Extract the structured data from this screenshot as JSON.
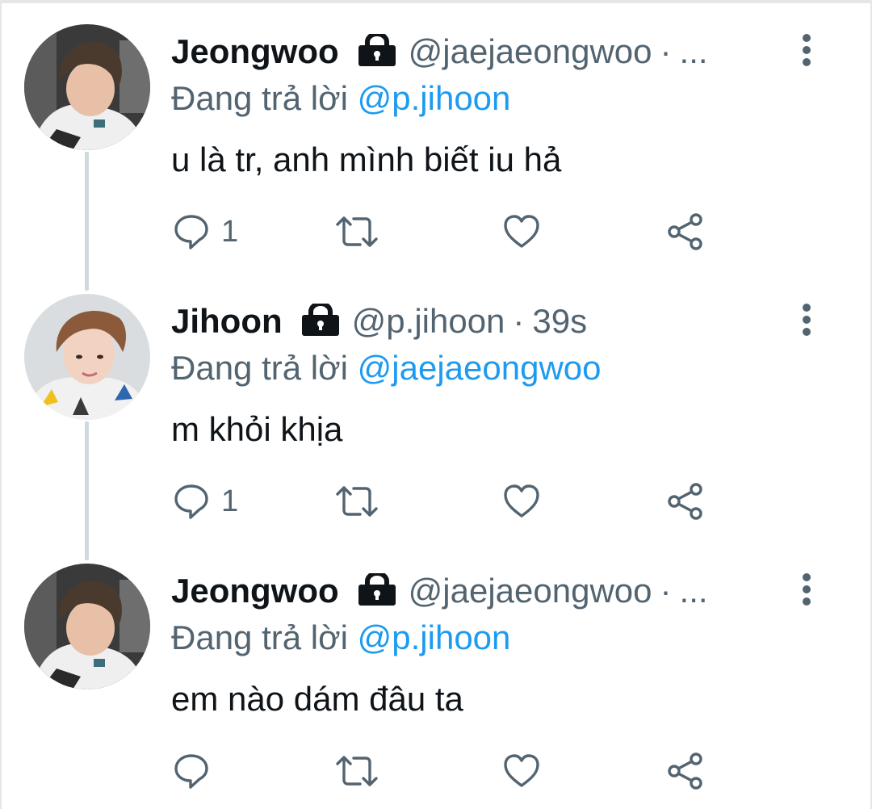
{
  "colors": {
    "name": "#0f1419",
    "secondary": "#536471",
    "mention": "#1d9bf0",
    "thread_line": "#cfd9de"
  },
  "tweets": [
    {
      "name": "Jeongwoo",
      "handle": "@jaejaeongwoo",
      "separator": "·",
      "time": "...",
      "reply_prefix": "Đang trả lời",
      "reply_to": "@p.jihoon",
      "text": "u là tr, anh mình biết iu hả",
      "reply_count": "1",
      "icons": [
        "lock-icon",
        "more-vertical-icon",
        "reply-icon",
        "retweet-icon",
        "like-icon",
        "share-icon"
      ]
    },
    {
      "name": "Jihoon",
      "handle": "@p.jihoon",
      "separator": "·",
      "time": "39s",
      "reply_prefix": "Đang trả lời",
      "reply_to": "@jaejaeongwoo",
      "text": "m khỏi khịa",
      "reply_count": "1",
      "icons": [
        "lock-icon",
        "more-vertical-icon",
        "reply-icon",
        "retweet-icon",
        "like-icon",
        "share-icon"
      ]
    },
    {
      "name": "Jeongwoo",
      "handle": "@jaejaeongwoo",
      "separator": "·",
      "time": "...",
      "reply_prefix": "Đang trả lời",
      "reply_to": "@p.jihoon",
      "text": "em nào dám đâu ta",
      "reply_count": "",
      "icons": [
        "lock-icon",
        "more-vertical-icon",
        "reply-icon",
        "retweet-icon",
        "like-icon",
        "share-icon"
      ]
    }
  ]
}
